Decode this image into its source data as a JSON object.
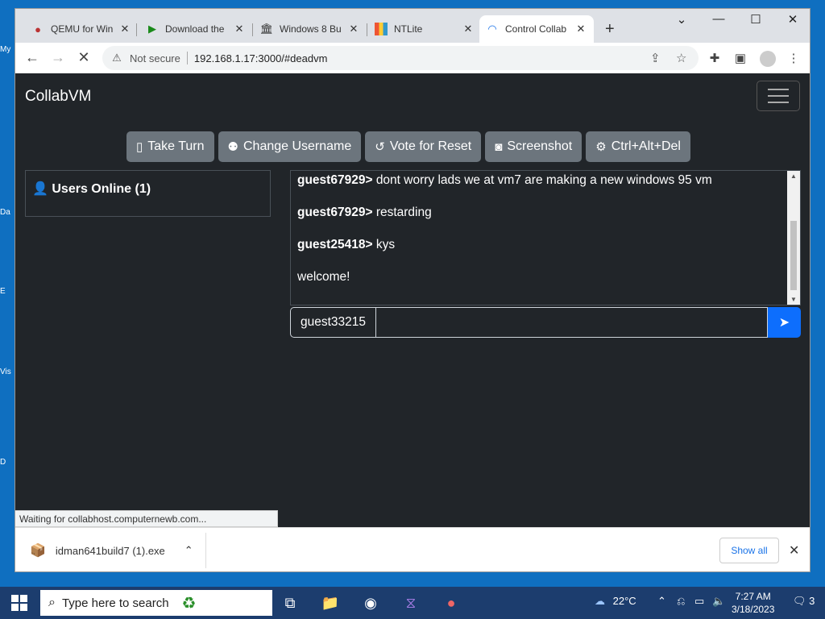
{
  "browser": {
    "tabs": [
      {
        "title": "QEMU for Win",
        "icon": "qemu-icon"
      },
      {
        "title": "Download the",
        "icon": "play-icon"
      },
      {
        "title": "Windows 8 Bu",
        "icon": "bank-icon"
      },
      {
        "title": "NTLite",
        "icon": "ntlite-icon"
      },
      {
        "title": "Control Collab",
        "icon": "loading-icon",
        "active": true
      }
    ],
    "security_label": "Not secure",
    "url": "192.168.1.17:3000/#deadvm",
    "status_text": "Waiting for collabhost.computernewb.com..."
  },
  "page": {
    "brand": "CollabVM",
    "buttons": [
      {
        "label": "Take Turn",
        "icon": "mouse-icon"
      },
      {
        "label": "Change Username",
        "icon": "user-edit-icon"
      },
      {
        "label": "Vote for Reset",
        "icon": "undo-icon"
      },
      {
        "label": "Screenshot",
        "icon": "camera-icon"
      },
      {
        "label": "Ctrl+Alt+Del",
        "icon": "gear-icon"
      }
    ],
    "users_online": "Users Online (1)",
    "chat": [
      {
        "user": "guest67929>",
        "text": "dont worry lads we at vm7 are making a new windows 95 vm"
      },
      {
        "user": "guest67929>",
        "text": "restarding"
      },
      {
        "user": "guest25418>",
        "text": "kys"
      },
      {
        "user": "",
        "text": "welcome!"
      }
    ],
    "username": "guest33215",
    "chat_input_value": ""
  },
  "downloads": {
    "file": "idman641build7 (1).exe",
    "show_all": "Show all"
  },
  "taskbar": {
    "search_placeholder": "Type here to search",
    "weather": "22°C",
    "time": "7:27 AM",
    "date": "3/18/2023",
    "notifications": "3"
  }
}
